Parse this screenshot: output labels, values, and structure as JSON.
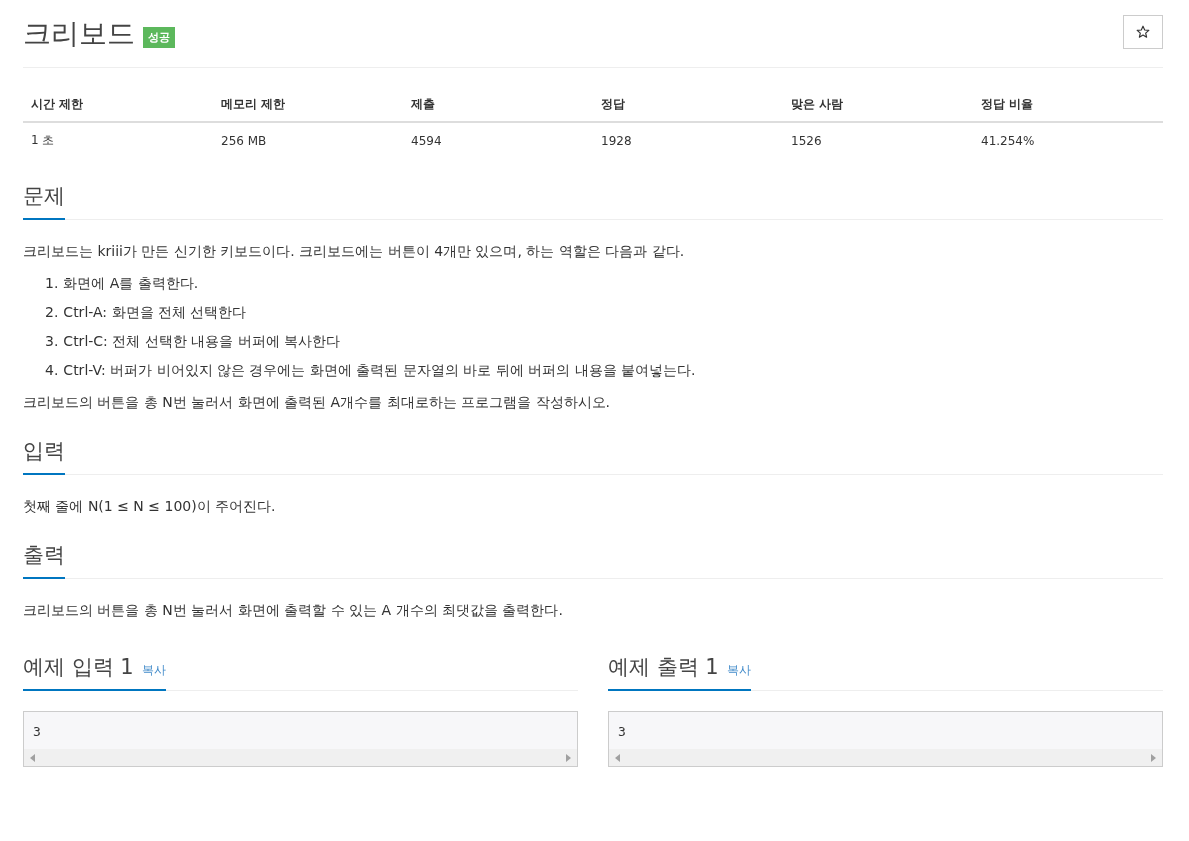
{
  "title": "크리보드",
  "badge": "성공",
  "info_table": {
    "columns": [
      "시간 제한",
      "메모리 제한",
      "제출",
      "정답",
      "맞은 사람",
      "정답 비율"
    ],
    "rows": [
      [
        "1 초",
        "256 MB",
        "4594",
        "1928",
        "1526",
        "41.254%"
      ]
    ]
  },
  "sections": [
    {
      "heading": "문제",
      "kind": "problem",
      "paragraphs": [
        "크리보드는 kriii가 만든 신기한 키보드이다. 크리보드에는 버튼이 4개만 있으며, 하는 역할은 다음과 같다."
      ],
      "list": [
        {
          "number": "1.",
          "text": "화면에 A를 출력한다."
        },
        {
          "number": "2.",
          "text": "Ctrl-A: 화면을 전체 선택한다"
        },
        {
          "number": "3.",
          "text": "Ctrl-C: 전체 선택한 내용을 버퍼에 복사한다"
        },
        {
          "number": "4.",
          "text": "Ctrl-V: 버퍼가 비어있지 않은 경우에는 화면에 출력된 문자열의 바로 뒤에 버퍼의 내용을 붙여넣는다."
        }
      ],
      "after": [
        "크리보드의 버튼을 총 N번 눌러서 화면에 출력된 A개수를 최대로하는 프로그램을 작성하시오."
      ]
    },
    {
      "heading": "입력",
      "kind": "plain",
      "paragraphs": [
        "첫째 줄에 N(1 ≤ N ≤ 100)이 주어진다."
      ]
    },
    {
      "heading": "출력",
      "kind": "plain",
      "paragraphs": [
        "크리보드의 버튼을 총 N번 눌러서 화면에 출력할 수 있는 A 개수의 최댓값을 출력한다."
      ]
    }
  ],
  "samples": [
    {
      "heading": "예제 입력 1",
      "copy": "복사",
      "content": "3"
    },
    {
      "heading": "예제 출력 1",
      "copy": "복사",
      "content": "3"
    }
  ]
}
